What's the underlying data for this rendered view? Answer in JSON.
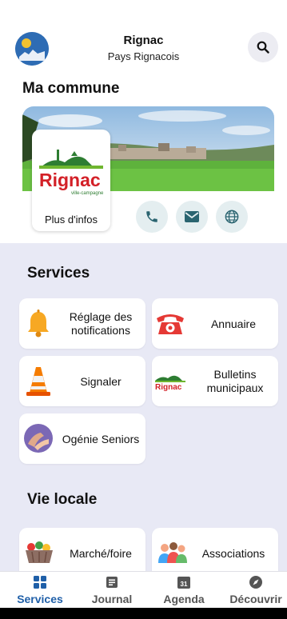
{
  "header": {
    "title": "Rignac",
    "subtitle": "Pays Rignacois",
    "logo_icon": "city-logo-icon",
    "search_icon": "search-icon"
  },
  "commune": {
    "heading": "Ma commune",
    "logo_text": "Rignac",
    "logo_tagline": "ville-campagne",
    "more_info_label": "Plus d'infos",
    "contacts": [
      "phone-icon",
      "mail-icon",
      "globe-icon"
    ]
  },
  "services": {
    "heading": "Services",
    "tiles": [
      {
        "label": "Réglage des notifications",
        "icon": "bell-icon"
      },
      {
        "label": "Annuaire",
        "icon": "telephone-icon"
      },
      {
        "label": "Signaler",
        "icon": "traffic-cone-icon"
      },
      {
        "label": "Bulletins municipaux",
        "icon": "bulletin-logo-icon"
      },
      {
        "label": "Ogénie Seniors",
        "icon": "seniors-icon"
      }
    ]
  },
  "vie_locale": {
    "heading": "Vie locale",
    "tiles": [
      {
        "label": "Marché/foire",
        "icon": "market-basket-icon"
      },
      {
        "label": "Associations",
        "icon": "people-icon"
      }
    ]
  },
  "nav": {
    "items": [
      {
        "label": "Services",
        "icon": "grid-icon",
        "active": true
      },
      {
        "label": "Journal",
        "icon": "newspaper-icon",
        "active": false
      },
      {
        "label": "Agenda",
        "icon": "calendar-icon",
        "active": false,
        "badge": "31"
      },
      {
        "label": "Découvrir",
        "icon": "compass-icon",
        "active": false
      }
    ]
  },
  "colors": {
    "accent": "#1f5fa8",
    "services_bg": "#e8e9f5",
    "contact_bg": "#e4eef0"
  }
}
